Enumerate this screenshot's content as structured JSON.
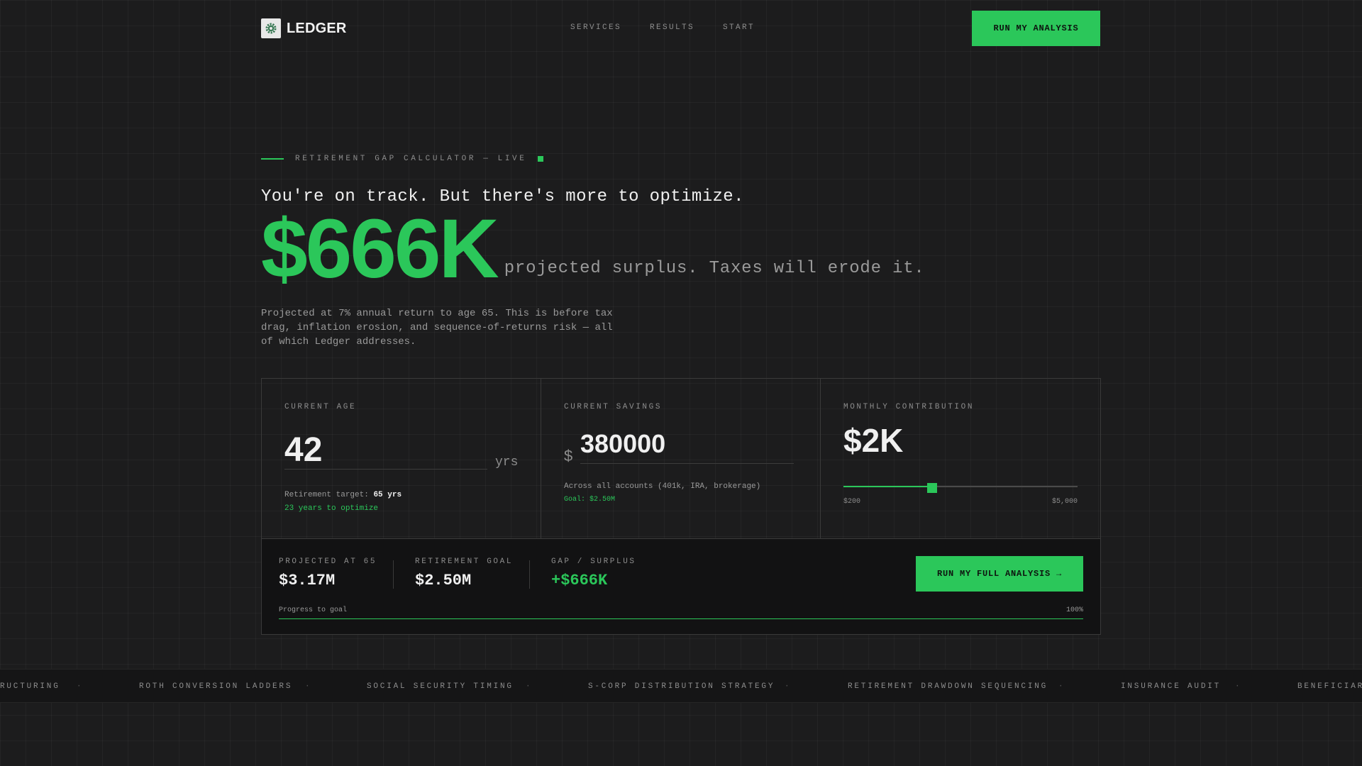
{
  "brand": {
    "name": "LEDGER",
    "logo_icon": "gear-icon"
  },
  "nav": {
    "links": [
      "SERVICES",
      "RESULTS",
      "START"
    ],
    "cta_label": "RUN MY ANALYSIS"
  },
  "hero": {
    "eyebrow": "RETIREMENT GAP CALCULATOR — LIVE",
    "headline": "You're on track. But there's more to optimize.",
    "big_number": "$666K",
    "big_suffix": "projected surplus. Taxes will erode it.",
    "body": "Projected at 7% annual return to age 65. This is before tax drag, inflation erosion, and sequence-of-returns risk — all of which Ledger addresses."
  },
  "calculator": {
    "age": {
      "label": "CURRENT AGE",
      "value": "42",
      "unit": "yrs",
      "target_prefix": "Retirement target:",
      "target_value": "65 yrs",
      "note": "23 years to optimize"
    },
    "savings": {
      "label": "CURRENT SAVINGS",
      "currency": "$",
      "value": "380000",
      "note": "Across all accounts (401k, IRA, brokerage)",
      "goal": "Goal: $2.50M"
    },
    "contribution": {
      "label": "MONTHLY CONTRIBUTION",
      "value": "$2K",
      "slider_min": "$200",
      "slider_max": "$5,000",
      "slider_fraction": 0.38
    }
  },
  "results": {
    "projected_label": "PROJECTED AT 65",
    "projected_value": "$3.17M",
    "goal_label": "RETIREMENT GOAL",
    "goal_value": "$2.50M",
    "gap_label": "GAP / SURPLUS",
    "gap_value": "+$666K",
    "cta_label": "RUN MY FULL ANALYSIS →",
    "progress_label": "Progress to goal",
    "progress_pct": "100%",
    "progress_fraction": 1.0
  },
  "ticker": {
    "items": [
      "RUCTURING",
      "ROTH CONVERSION LADDERS",
      "SOCIAL SECURITY TIMING",
      "S-CORP DISTRIBUTION STRATEGY",
      "RETIREMENT DRAWDOWN SEQUENCING",
      "INSURANCE AUDIT",
      "BENEFICIAR"
    ],
    "separator": "·"
  },
  "colors": {
    "accent": "#2bc75a",
    "background": "#1c1c1d",
    "panel_dark": "#121213"
  }
}
